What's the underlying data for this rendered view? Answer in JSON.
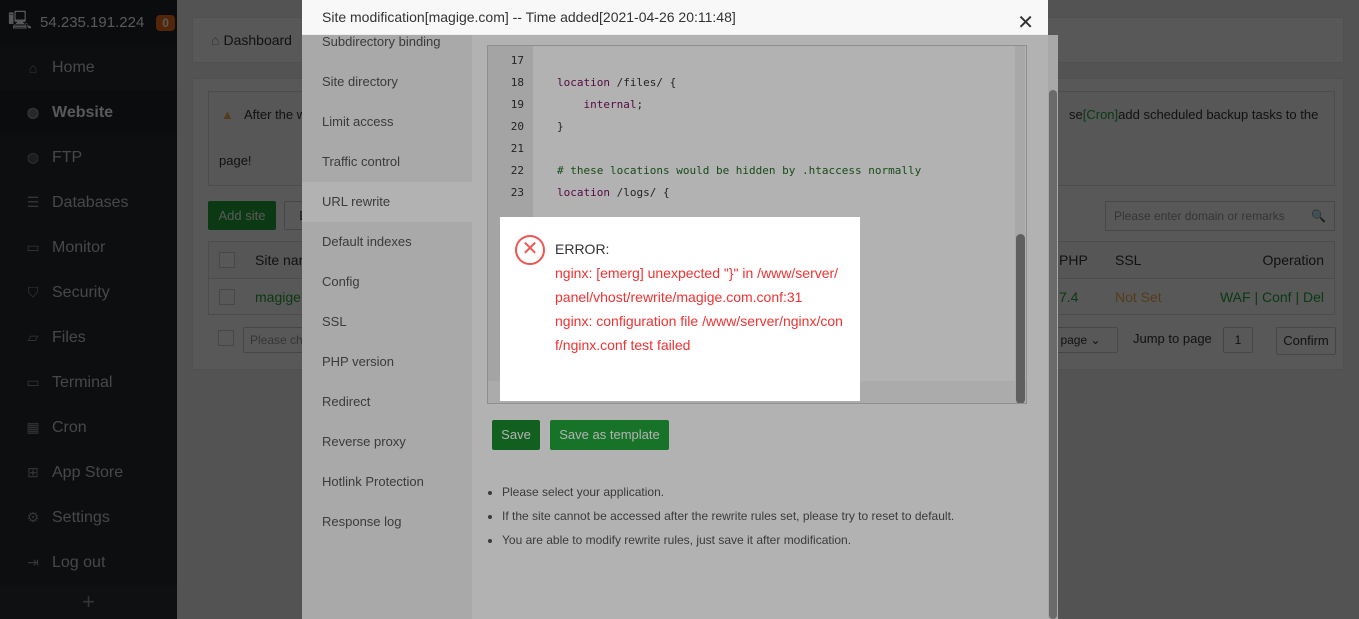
{
  "sidebar": {
    "ip": "54.235.191.224",
    "badge": "0",
    "items": [
      {
        "label": "Home",
        "icon": "⌂"
      },
      {
        "label": "Website",
        "icon": "◍"
      },
      {
        "label": "FTP",
        "icon": "◍"
      },
      {
        "label": "Databases",
        "icon": "☰"
      },
      {
        "label": "Monitor",
        "icon": "▭"
      },
      {
        "label": "Security",
        "icon": "⛉"
      },
      {
        "label": "Files",
        "icon": "▱"
      },
      {
        "label": "Terminal",
        "icon": "▭"
      },
      {
        "label": "Cron",
        "icon": "▦"
      },
      {
        "label": "App Store",
        "icon": "⊞"
      },
      {
        "label": "Settings",
        "icon": "⚙"
      },
      {
        "label": "Log out",
        "icon": "⇥"
      }
    ],
    "plus": "+"
  },
  "main": {
    "breadcrumb": "Dashboard",
    "alert_start": "After the w",
    "alert_end": "se",
    "alert_cron": "[Cron]",
    "alert_rest": "add scheduled backup tasks to the",
    "alert_line2": "page!",
    "add_site": "Add site",
    "btn2": "D",
    "search_placeholder": "Please enter domain or remarks",
    "table": {
      "headers": {
        "name": "Site nam",
        "php": "PHP",
        "ssl": "SSL",
        "op": "Operation"
      },
      "row": {
        "name": "magige.",
        "php": "7.4",
        "ssl": "Not Set",
        "waf": "WAF",
        "conf": "Conf",
        "del": "Del"
      }
    },
    "pager": {
      "batch_placeholder": "Please ch",
      "per_page": "page",
      "jump_label": "Jump to page",
      "jump_value": "1",
      "confirm": "Confirm"
    }
  },
  "modal": {
    "title": "Site modification[magige.com] -- Time added[2021-04-26 20:11:48]",
    "close": "✕",
    "menu": [
      "Subdirectory binding",
      "Site directory",
      "Limit access",
      "Traffic control",
      "URL rewrite",
      "Default indexes",
      "Config",
      "SSL",
      "PHP version",
      "Redirect",
      "Reverse proxy",
      "Hotlink Protection",
      "Response log"
    ],
    "editor": {
      "lines": [
        {
          "n": "17",
          "t": ""
        },
        {
          "n": "18",
          "k": "location",
          "t": " /files/ {"
        },
        {
          "n": "19",
          "k": "    internal",
          "t": ";"
        },
        {
          "n": "20",
          "t": "}"
        },
        {
          "n": "21",
          "t": ""
        },
        {
          "n": "22",
          "c": "# these locations would be hidden by .htaccess normally"
        },
        {
          "n": "23",
          "k": "location",
          "t": " /logs/ {"
        }
      ]
    },
    "save": "Save",
    "save_template": "Save as template",
    "notes": [
      "Please select your application.",
      "If the site cannot be accessed after the rewrite rules set, please try to reset to default.",
      "You are able to modify rewrite rules, just save it after modification."
    ]
  },
  "error": {
    "title": "ERROR:",
    "line1": "nginx: [emerg] unexpected \"}\" in /www/server/panel/vhost/rewrite/magige.com.conf:31",
    "line2": "nginx: configuration file /www/server/nginx/conf/nginx.conf test failed"
  }
}
